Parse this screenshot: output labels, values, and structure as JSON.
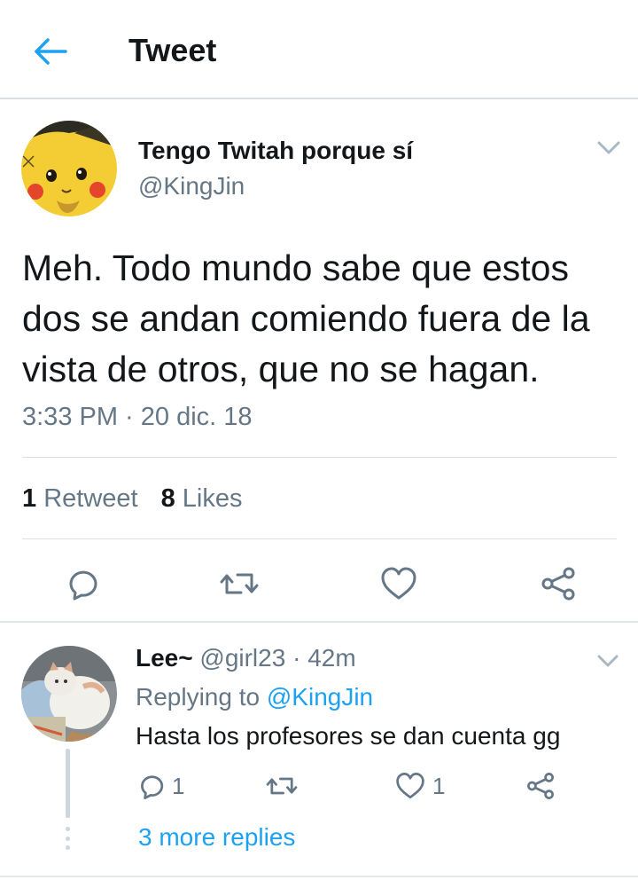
{
  "header": {
    "title": "Tweet",
    "back_icon": "arrow-left-icon"
  },
  "colors": {
    "accent": "#1da1f2",
    "text_primary": "#14171a",
    "text_secondary": "#657786",
    "divider": "#e1e8ed"
  },
  "tweet": {
    "display_name": "Tengo Twitah porque sí",
    "handle": "@KingJin",
    "avatar_icon": "pikachu-avatar",
    "text": "Meh. Todo mundo sabe que estos dos se andan comiendo fuera de la vista de otros, que no se hagan.",
    "timestamp": "3:33 PM · 20 dic. 18",
    "retweet_count": "1",
    "retweet_label": "Retweet",
    "like_count": "8",
    "like_label": "Likes",
    "actions": [
      "reply-icon",
      "retweet-icon",
      "like-icon",
      "share-icon"
    ]
  },
  "reply": {
    "display_name": "Lee~",
    "handle": "@girl23",
    "time": "42m",
    "avatar_icon": "cat-avatar",
    "replying_prefix": "Replying to",
    "replying_to": "@KingJin",
    "text": "Hasta los profesores se dan cuenta gg",
    "reply_count": "1",
    "like_count": "1",
    "more_replies": "3 more replies"
  }
}
